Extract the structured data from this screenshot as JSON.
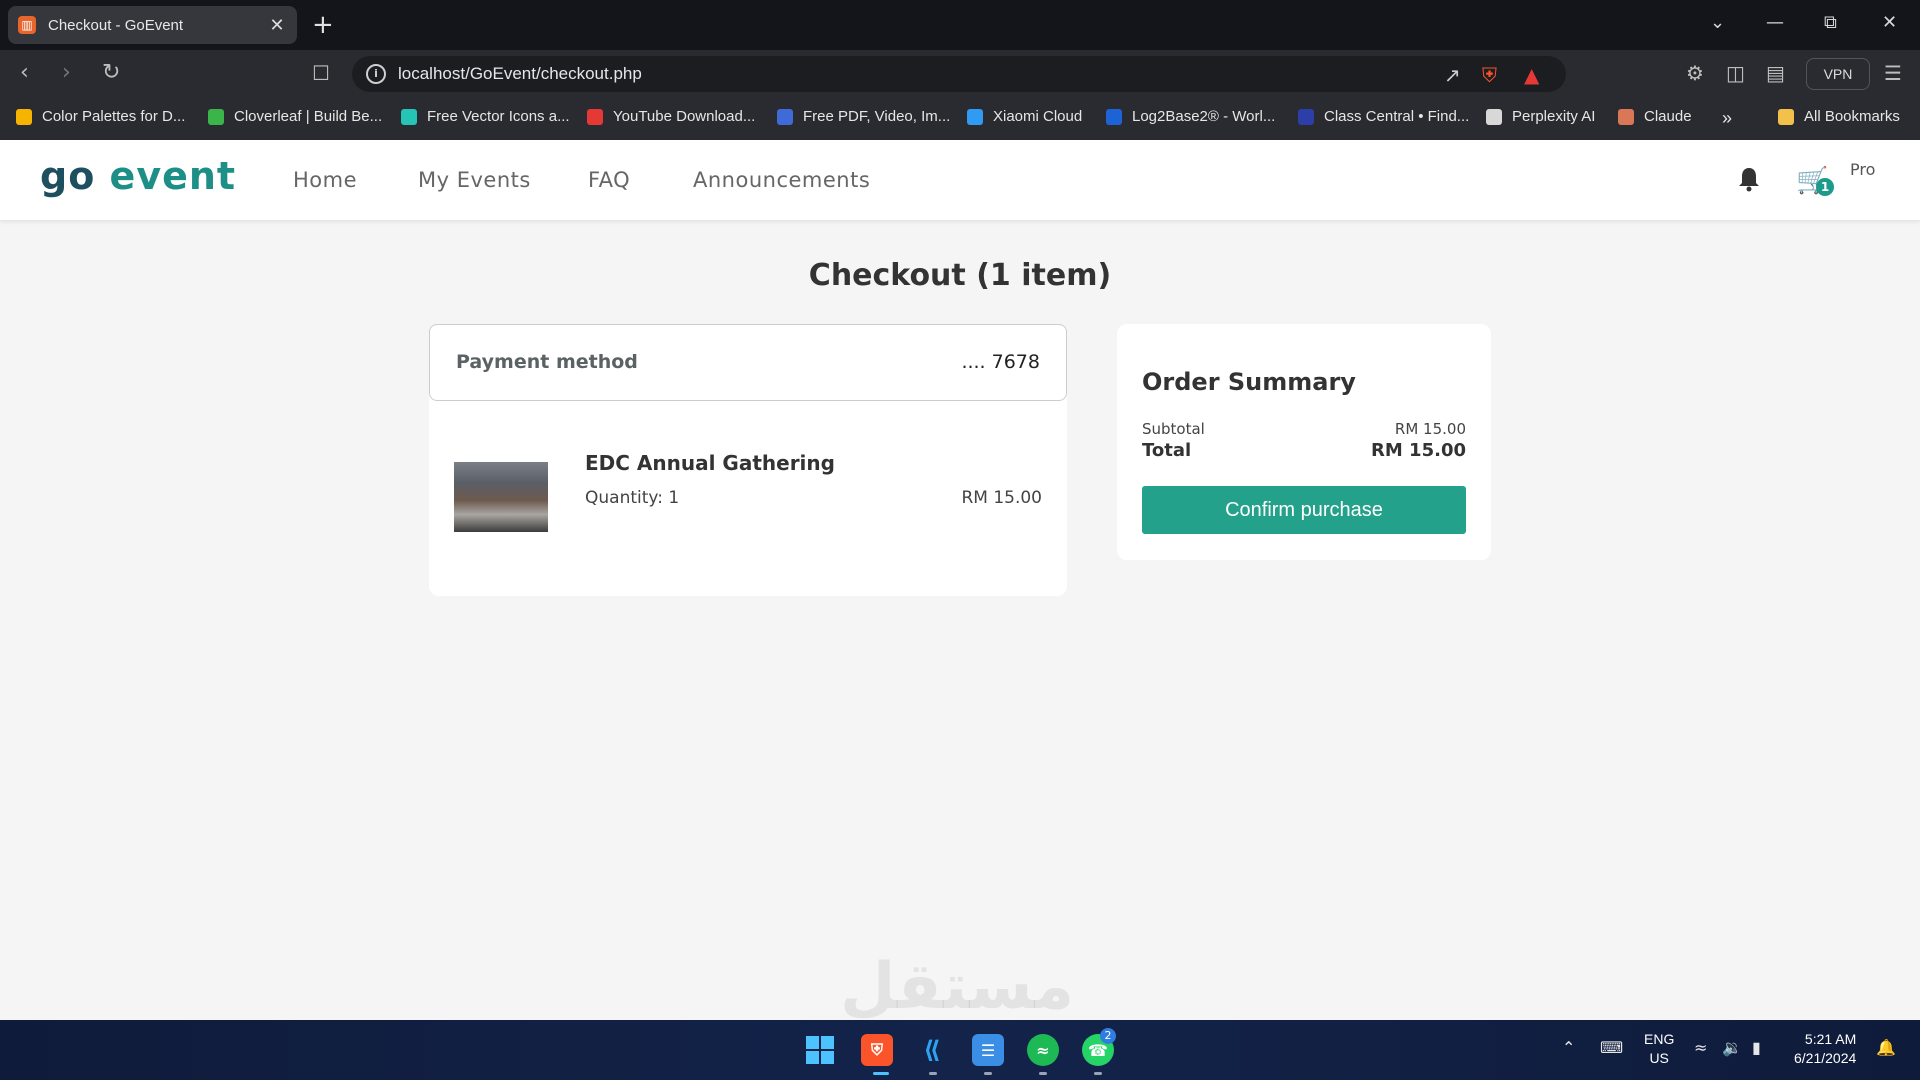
{
  "browser": {
    "tab_title": "Checkout - GoEvent",
    "new_tab": "+",
    "url": "localhost/GoEvent/checkout.php",
    "vpn_label": "VPN",
    "bookmarks": [
      {
        "label": "Color Palettes for D...",
        "color": "#f4b400"
      },
      {
        "label": "Cloverleaf | Build Be...",
        "color": "#3bb54a"
      },
      {
        "label": "Free Vector Icons a...",
        "color": "#25c4b4"
      },
      {
        "label": "YouTube Download...",
        "color": "#e53935"
      },
      {
        "label": "Free PDF, Video, Im...",
        "color": "#3f6ad8"
      },
      {
        "label": "Xiaomi Cloud",
        "color": "#2f9bf2"
      },
      {
        "label": "Log2Base2® - Worl...",
        "color": "#1e63d6"
      },
      {
        "label": "Class Central • Find...",
        "color": "#2c3ea8"
      },
      {
        "label": "Perplexity AI",
        "color": "#d8d8d8"
      },
      {
        "label": "Claude",
        "color": "#d97757"
      }
    ],
    "all_bookmarks": "All Bookmarks"
  },
  "site": {
    "logo_go": "go",
    "logo_event": "event",
    "nav": [
      "Home",
      "My Events",
      "FAQ",
      "Announcements"
    ],
    "cart_count": "1",
    "avatar_alt": "Pro"
  },
  "checkout": {
    "title_bold": "Checkout",
    "title_count": "(1 item)",
    "payment_label": "Payment method",
    "payment_value": ".... 7678",
    "item": {
      "name": "EDC Annual Gathering",
      "quantity": "Quantity: 1",
      "price": "RM 15.00"
    },
    "summary": {
      "title": "Order Summary",
      "subtotal_label": "Subtotal",
      "subtotal_value": "RM 15.00",
      "total_label": "Total",
      "total_value": "RM 15.00",
      "confirm_label": "Confirm purchase"
    }
  },
  "watermark": "مستقل",
  "taskbar": {
    "whatsapp_badge": "2",
    "lang_top": "ENG",
    "lang_bottom": "US",
    "time": "5:21 AM",
    "date": "6/21/2024"
  },
  "colors": {
    "accent": "#24a18a",
    "logo_dark": "#1e4f5e",
    "logo_teal": "#1e8f87"
  }
}
